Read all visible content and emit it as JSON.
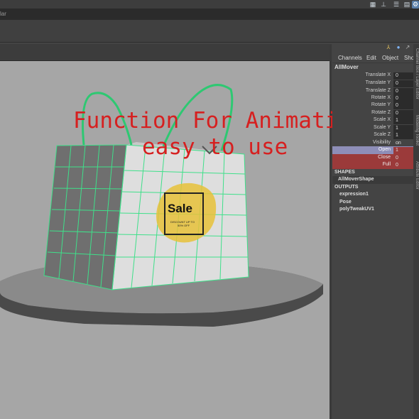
{
  "app": {
    "tab_label": "lar"
  },
  "toolbar": {
    "icons": [
      "render-icon",
      "layout-icon",
      "list-icon",
      "grid-icon",
      "settings-icon"
    ]
  },
  "overlay": {
    "line1": "Function For Animation",
    "line2": "easy to use"
  },
  "bag": {
    "sale": "Sale",
    "fine_line1": "DISCOUNT UP TO",
    "fine_line2": "50% OFF"
  },
  "channel_box": {
    "menu": [
      "Channels",
      "Edit",
      "Object",
      "Show"
    ],
    "side_tabs": [
      "Channel Box / Layer Editor",
      "Modeling Toolkit",
      "Attribute Editor"
    ],
    "node_name": "AllMover",
    "attributes": [
      {
        "label": "Translate X",
        "value": "0"
      },
      {
        "label": "Translate Y",
        "value": "0"
      },
      {
        "label": "Translate Z",
        "value": "0"
      },
      {
        "label": "Rotate X",
        "value": "0"
      },
      {
        "label": "Rotate Y",
        "value": "0"
      },
      {
        "label": "Rotate Z",
        "value": "0"
      },
      {
        "label": "Scale X",
        "value": "1"
      },
      {
        "label": "Scale Y",
        "value": "1"
      },
      {
        "label": "Scale Z",
        "value": "1"
      },
      {
        "label": "Visibility",
        "value": "on"
      }
    ],
    "custom_attributes": [
      {
        "label": "Open",
        "value": "1"
      },
      {
        "label": "Close",
        "value": "0"
      },
      {
        "label": "Full",
        "value": "0"
      }
    ],
    "shapes_title": "SHAPES",
    "shape": "AllMoverShape",
    "outputs_title": "OUTPUTS",
    "outputs": [
      "expression1",
      "Pose",
      "polyTweakUV1"
    ]
  },
  "colors": {
    "overlay_text": "#d62020",
    "wireframe": "#3fe08a",
    "highlight_row": "#8e8eb8",
    "keyed_row": "#9b3a3a",
    "sale_blob": "#e8c23a"
  }
}
